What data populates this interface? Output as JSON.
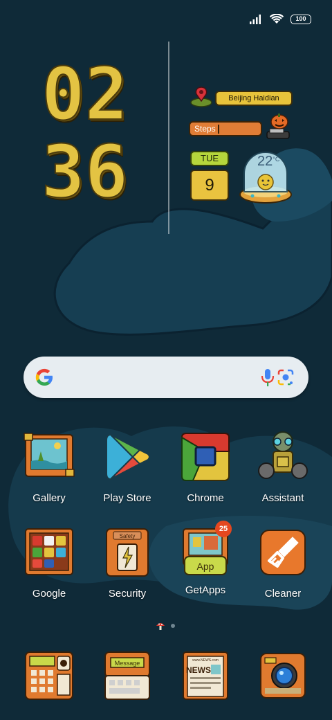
{
  "status_bar": {
    "battery": "100"
  },
  "clock": {
    "hours": "02",
    "minutes": "36"
  },
  "widgets": {
    "location": "Beijing Haidian",
    "steps_label": "Steps",
    "day": "TUE",
    "date": "9",
    "temperature": "22",
    "temperature_unit": "°C"
  },
  "apps_row1": [
    {
      "label": "Gallery"
    },
    {
      "label": "Play Store"
    },
    {
      "label": "Chrome"
    },
    {
      "label": "Assistant"
    }
  ],
  "apps_row2": [
    {
      "label": "Google"
    },
    {
      "label": "Security",
      "icon_text": "Safety"
    },
    {
      "label": "GetApps",
      "badge": "25",
      "icon_text": "App"
    },
    {
      "label": "Cleaner"
    }
  ],
  "dock": [
    {
      "name": "phone"
    },
    {
      "name": "messages",
      "icon_text": "Message"
    },
    {
      "name": "browser",
      "icon_text": "NEWS",
      "icon_subtext": "www.NEWS.com"
    },
    {
      "name": "camera"
    }
  ],
  "colors": {
    "wallpaper": "#0f2a38",
    "gold": "#e3c343",
    "orange": "#e07d36",
    "green": "#b5d63c"
  }
}
